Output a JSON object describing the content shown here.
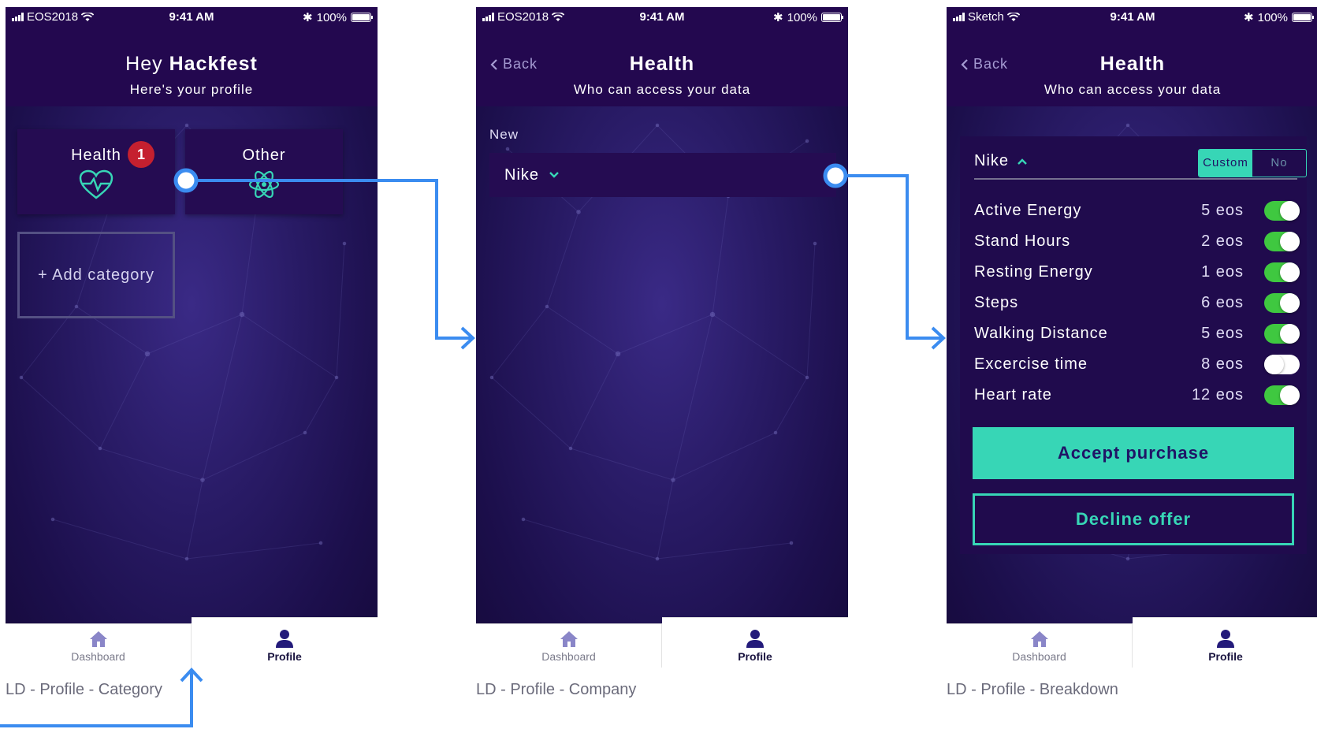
{
  "colors": {
    "accent": "#37d6b6",
    "connector": "#3b8cf0",
    "badge": "#c5202f",
    "toggle_on": "#3fc840",
    "header_bg": "#23084f"
  },
  "screens": [
    {
      "caption": "LD - Profile - Category",
      "status": {
        "carrier": "EOS2018",
        "time": "9:41 AM",
        "battery": "100%"
      },
      "header": {
        "greeting": "Hey",
        "name": "Hackfest",
        "subtitle": "Here's your profile"
      },
      "cards": [
        {
          "label": "Health",
          "badge": "1",
          "icon": "heart-pulse-icon"
        },
        {
          "label": "Other",
          "icon": "atom-icon"
        }
      ],
      "add_category": "+ Add category",
      "tabs": {
        "dashboard": "Dashboard",
        "profile": "Profile"
      }
    },
    {
      "caption": "LD - Profile - Company",
      "status": {
        "carrier": "EOS2018",
        "time": "9:41 AM",
        "battery": "100%"
      },
      "header": {
        "back": "Back",
        "title": "Health",
        "subtitle": "Who can access your data"
      },
      "new_label": "New",
      "company": "Nike",
      "tabs": {
        "dashboard": "Dashboard",
        "profile": "Profile"
      }
    },
    {
      "caption": "LD - Profile - Breakdown",
      "status": {
        "carrier": "Sketch",
        "time": "9:41 AM",
        "battery": "100%"
      },
      "header": {
        "back": "Back",
        "title": "Health",
        "subtitle": "Who can access your data"
      },
      "company": "Nike",
      "segment": {
        "custom": "Custom",
        "no": "No",
        "selected": "Custom"
      },
      "rows": [
        {
          "name": "Active Energy",
          "value": "5 eos",
          "enabled": true
        },
        {
          "name": "Stand Hours",
          "value": "2 eos",
          "enabled": true
        },
        {
          "name": "Resting Energy",
          "value": "1 eos",
          "enabled": true
        },
        {
          "name": "Steps",
          "value": "6 eos",
          "enabled": true
        },
        {
          "name": "Walking Distance",
          "value": "5 eos",
          "enabled": true
        },
        {
          "name": "Excercise time",
          "value": "8 eos",
          "enabled": false
        },
        {
          "name": "Heart rate",
          "value": "12 eos",
          "enabled": true
        }
      ],
      "accept": "Accept purchase",
      "decline": "Decline offer",
      "tabs": {
        "dashboard": "Dashboard",
        "profile": "Profile"
      }
    }
  ]
}
